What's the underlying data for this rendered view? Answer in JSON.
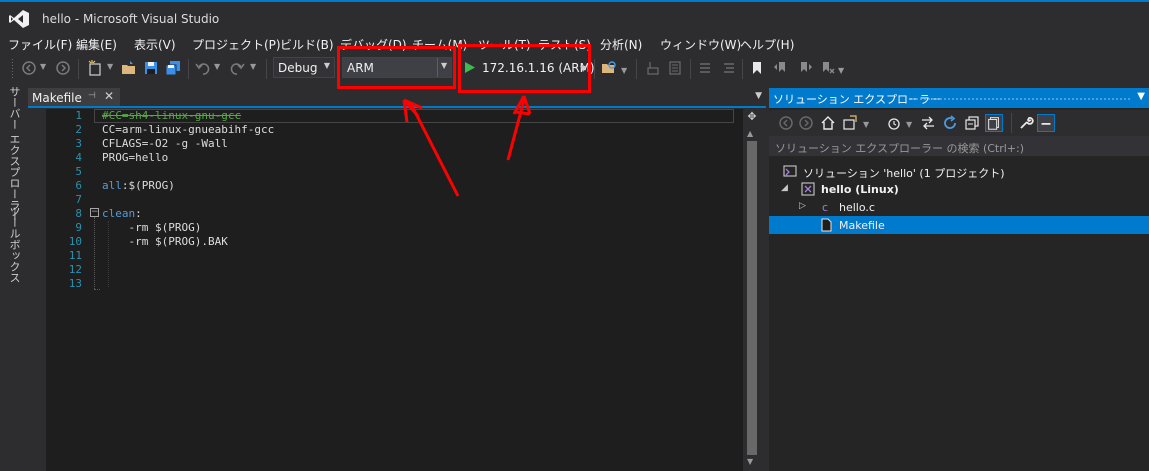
{
  "window": {
    "title": "hello - Microsoft Visual Studio"
  },
  "menu": [
    "ファイル(F)",
    "編集(E)",
    "表示(V)",
    "プロジェクト(P)",
    "ビルド(B)",
    "デバッグ(D)",
    "チーム(M)",
    "ツール(T)",
    "テスト(S)",
    "分析(N)",
    "ウィンドウ(W)",
    "ヘルプ(H)"
  ],
  "toolbar": {
    "configuration": "Debug",
    "platform": "ARM",
    "run_target": "172.16.1.16 (ARM)"
  },
  "left_strip": {
    "server_explorer": "サーバー エクスプローラー",
    "toolbox": "ツールボックス"
  },
  "editor": {
    "tab_title": "Makefile",
    "line_numbers": [
      "1",
      "2",
      "3",
      "4",
      "5",
      "6",
      "7",
      "8",
      "9",
      "10",
      "11",
      "12",
      "13"
    ],
    "lines": [
      "#CC=sh4-linux-gnu-gcc",
      "CC=arm-linux-gnueabihf-gcc",
      "CFLAGS=-O2 -g -Wall",
      "PROG=hello",
      "",
      "all:$(PROG)",
      "",
      "clean:",
      "    -rm $(PROG)",
      "    -rm $(PROG).BAK",
      "",
      "",
      ""
    ],
    "all_keyword": "all",
    "all_rest": ":$(PROG)",
    "clean_keyword": "clean",
    "clean_rest": ":"
  },
  "solution_explorer": {
    "title": "ソリューション エクスプローラー",
    "search_placeholder": "ソリューション エクスプローラー の検索 (Ctrl+:)",
    "tree": {
      "solution": "ソリューション 'hello' (1 プロジェクト)",
      "project": "hello (Linux)",
      "file_c": "hello.c",
      "file_makefile": "Makefile"
    }
  },
  "colors": {
    "accent": "#007acc",
    "annotation": "#ff0000",
    "run_green": "#3fb950"
  }
}
